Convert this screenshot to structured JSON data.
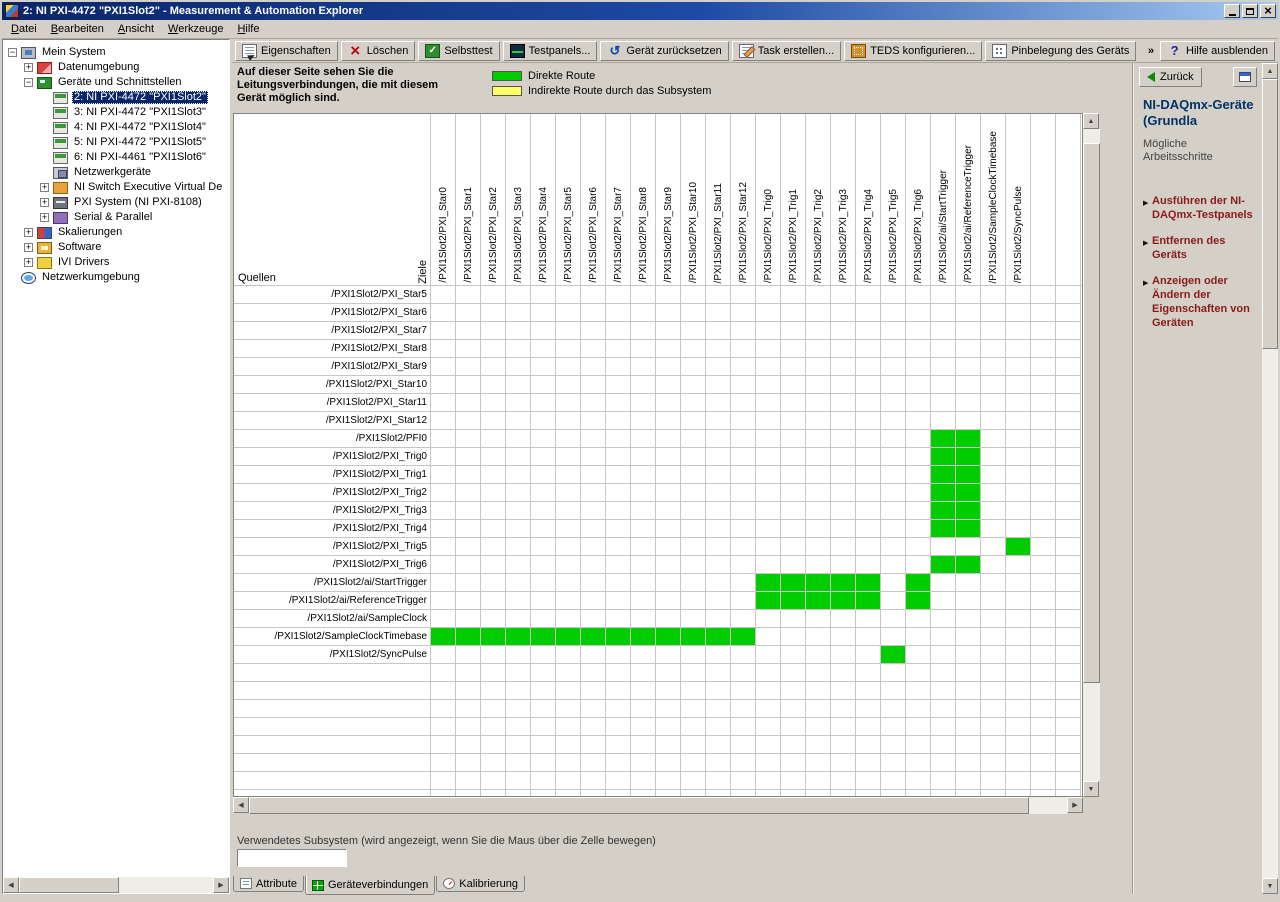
{
  "window": {
    "title": "2: NI PXI-4472 \"PXI1Slot2\" - Measurement & Automation Explorer"
  },
  "menubar": {
    "items": [
      "Datei",
      "Bearbeiten",
      "Ansicht",
      "Werkzeuge",
      "Hilfe"
    ]
  },
  "toolbar": {
    "buttons": [
      {
        "label": "Eigenschaften",
        "icon": "properties-icon"
      },
      {
        "label": "Löschen",
        "icon": "delete-icon"
      },
      {
        "label": "Selbsttest",
        "icon": "selftest-icon"
      },
      {
        "label": "Testpanels...",
        "icon": "testpanels-icon"
      },
      {
        "label": "Gerät zurücksetzen",
        "icon": "reset-device-icon"
      },
      {
        "label": "Task erstellen...",
        "icon": "create-task-icon"
      },
      {
        "label": "TEDS konfigurieren...",
        "icon": "teds-icon"
      },
      {
        "label": "Pinbelegung des Geräts",
        "icon": "pinout-icon"
      }
    ],
    "overflow": "»",
    "help_button": {
      "label": "Hilfe ausblenden",
      "icon": "help-icon"
    }
  },
  "tree": {
    "items": [
      {
        "label": "Mein System",
        "level": 0,
        "expander": "minus",
        "icon": "computer-icon",
        "selected": false
      },
      {
        "label": "Datenumgebung",
        "level": 1,
        "expander": "plus",
        "icon": "data-neighborhood-icon",
        "selected": false
      },
      {
        "label": "Geräte und Schnittstellen",
        "level": 1,
        "expander": "minus",
        "icon": "devices-icon",
        "selected": false
      },
      {
        "label": "2: NI PXI-4472 \"PXI1Slot2\"",
        "level": 2,
        "expander": null,
        "icon": "daq-device-icon",
        "selected": true
      },
      {
        "label": "3: NI PXI-4472 \"PXI1Slot3\"",
        "level": 2,
        "expander": null,
        "icon": "daq-device-icon",
        "selected": false
      },
      {
        "label": "4: NI PXI-4472 \"PXI1Slot4\"",
        "level": 2,
        "expander": null,
        "icon": "daq-device-icon",
        "selected": false
      },
      {
        "label": "5: NI PXI-4472 \"PXI1Slot5\"",
        "level": 2,
        "expander": null,
        "icon": "daq-device-icon",
        "selected": false
      },
      {
        "label": "6: NI PXI-4461 \"PXI1Slot6\"",
        "level": 2,
        "expander": null,
        "icon": "daq-device-icon",
        "selected": false
      },
      {
        "label": "Netzwerkgeräte",
        "level": 2,
        "expander": null,
        "icon": "network-devices-icon",
        "selected": false
      },
      {
        "label": "NI Switch Executive Virtual De",
        "level": 2,
        "expander": "plus",
        "icon": "switch-executive-icon",
        "selected": false
      },
      {
        "label": "PXI System (NI PXI-8108)",
        "level": 2,
        "expander": "plus",
        "icon": "pxi-system-icon",
        "selected": false
      },
      {
        "label": "Serial & Parallel",
        "level": 2,
        "expander": "plus",
        "icon": "serial-parallel-icon",
        "selected": false
      },
      {
        "label": "Skalierungen",
        "level": 1,
        "expander": "plus",
        "icon": "scales-icon",
        "selected": false
      },
      {
        "label": "Software",
        "level": 1,
        "expander": "plus",
        "icon": "software-icon",
        "selected": false
      },
      {
        "label": "IVI Drivers",
        "level": 1,
        "expander": "plus",
        "icon": "ivi-drivers-icon",
        "selected": false
      },
      {
        "label": "Netzwerkumgebung",
        "level": 0,
        "expander": null,
        "icon": "network-neighborhood-icon",
        "selected": false
      }
    ]
  },
  "main": {
    "intro": {
      "description": "Auf dieser Seite sehen Sie die Leitungsverbindungen, die mit diesem Gerät möglich sind."
    },
    "legend": [
      {
        "color": "#00CC00",
        "label": "Direkte Route"
      },
      {
        "color": "#FFFF66",
        "label": "Indirekte Route durch das Subsystem"
      }
    ],
    "matrix": {
      "corner": {
        "sources": "Quellen",
        "targets": "Ziele"
      },
      "columns": [
        "/PXI1Slot2/PXI_Star0",
        "/PXI1Slot2/PXI_Star1",
        "/PXI1Slot2/PXI_Star2",
        "/PXI1Slot2/PXI_Star3",
        "/PXI1Slot2/PXI_Star4",
        "/PXI1Slot2/PXI_Star5",
        "/PXI1Slot2/PXI_Star6",
        "/PXI1Slot2/PXI_Star7",
        "/PXI1Slot2/PXI_Star8",
        "/PXI1Slot2/PXI_Star9",
        "/PXI1Slot2/PXI_Star10",
        "/PXI1Slot2/PXI_Star11",
        "/PXI1Slot2/PXI_Star12",
        "/PXI1Slot2/PXI_Trig0",
        "/PXI1Slot2/PXI_Trig1",
        "/PXI1Slot2/PXI_Trig2",
        "/PXI1Slot2/PXI_Trig3",
        "/PXI1Slot2/PXI_Trig4",
        "/PXI1Slot2/PXI_Trig5",
        "/PXI1Slot2/PXI_Trig6",
        "/PXI1Slot2/ai/StartTrigger",
        "/PXI1Slot2/ai/ReferenceTrigger",
        "/PXI1Slot2/SampleClockTimebase",
        "/PXI1Slot2/SyncPulse"
      ],
      "extra_columns": 2,
      "rows": [
        {
          "label": "/PXI1Slot2/PXI_Star5",
          "green": []
        },
        {
          "label": "/PXI1Slot2/PXI_Star6",
          "green": []
        },
        {
          "label": "/PXI1Slot2/PXI_Star7",
          "green": []
        },
        {
          "label": "/PXI1Slot2/PXI_Star8",
          "green": []
        },
        {
          "label": "/PXI1Slot2/PXI_Star9",
          "green": []
        },
        {
          "label": "/PXI1Slot2/PXI_Star10",
          "green": []
        },
        {
          "label": "/PXI1Slot2/PXI_Star11",
          "green": []
        },
        {
          "label": "/PXI1Slot2/PXI_Star12",
          "green": []
        },
        {
          "label": "/PXI1Slot2/PFI0",
          "green": [
            20,
            21
          ]
        },
        {
          "label": "/PXI1Slot2/PXI_Trig0",
          "green": [
            20,
            21
          ]
        },
        {
          "label": "/PXI1Slot2/PXI_Trig1",
          "green": [
            20,
            21
          ]
        },
        {
          "label": "/PXI1Slot2/PXI_Trig2",
          "green": [
            20,
            21
          ]
        },
        {
          "label": "/PXI1Slot2/PXI_Trig3",
          "green": [
            20,
            21
          ]
        },
        {
          "label": "/PXI1Slot2/PXI_Trig4",
          "green": [
            20,
            21
          ]
        },
        {
          "label": "/PXI1Slot2/PXI_Trig5",
          "green": [
            23
          ]
        },
        {
          "label": "/PXI1Slot2/PXI_Trig6",
          "green": [
            20,
            21
          ]
        },
        {
          "label": "/PXI1Slot2/ai/StartTrigger",
          "green": [
            13,
            14,
            15,
            16,
            17,
            19
          ]
        },
        {
          "label": "/PXI1Slot2/ai/ReferenceTrigger",
          "green": [
            13,
            14,
            15,
            16,
            17,
            19
          ]
        },
        {
          "label": "/PXI1Slot2/ai/SampleClock",
          "green": []
        },
        {
          "label": "/PXI1Slot2/SampleClockTimebase",
          "green": [
            0,
            1,
            2,
            3,
            4,
            5,
            6,
            7,
            8,
            9,
            10,
            11,
            12
          ]
        },
        {
          "label": "/PXI1Slot2/SyncPulse",
          "green": [
            18
          ]
        }
      ],
      "empty_rows": 8
    },
    "footer": {
      "note": "Verwendetes Subsystem (wird angezeigt, wenn Sie die Maus über die Zelle bewegen)",
      "value": ""
    },
    "tabs": [
      {
        "label": "Attribute",
        "icon": "attribute-icon",
        "selected": false
      },
      {
        "label": "Geräteverbindungen",
        "icon": "connections-icon",
        "selected": true
      },
      {
        "label": "Kalibrierung",
        "icon": "calibration-icon",
        "selected": false
      }
    ]
  },
  "help": {
    "back_label": "Zurück",
    "title": "NI-DAQmx-Geräte (Grundla",
    "steps_heading": "Mögliche Arbeitsschritte",
    "links": [
      "Ausführen der NI-DAQmx-Testpanels",
      "Entfernen des Geräts",
      "Anzeigen oder Ändern der Eigenschaften von Geräten"
    ]
  }
}
